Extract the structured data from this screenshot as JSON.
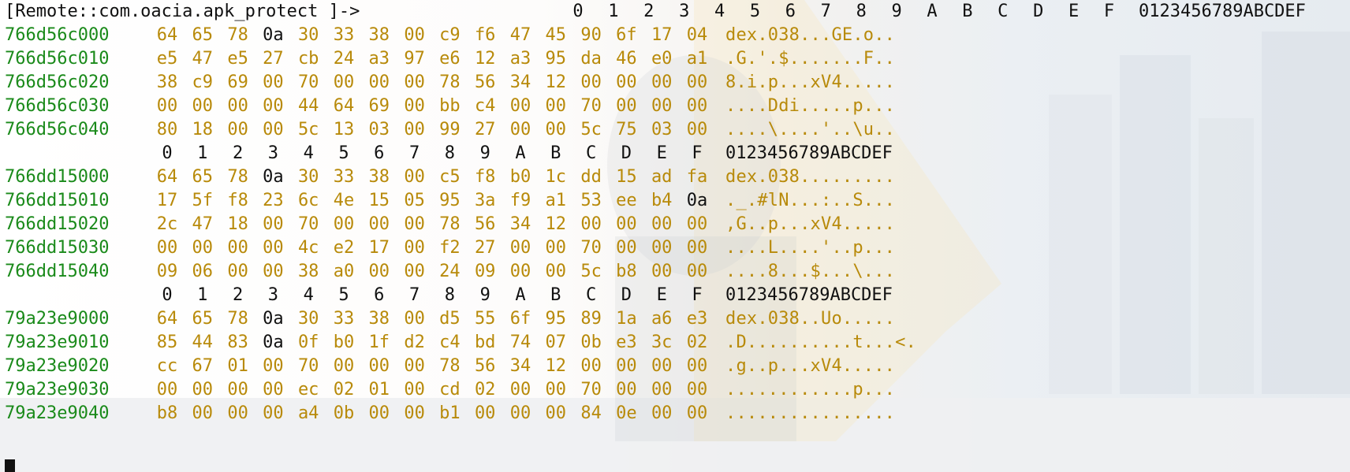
{
  "prompt": "[Remote::com.oacia.apk_protect ]->",
  "header": {
    "columns": [
      "0",
      "1",
      "2",
      "3",
      "4",
      "5",
      "6",
      "7",
      "8",
      "9",
      "A",
      "B",
      "C",
      "D",
      "E",
      "F"
    ],
    "ascii_label": "0123456789ABCDEF"
  },
  "blocks": [
    {
      "rows": [
        {
          "address": "766d56c000",
          "bytes": [
            "64",
            "65",
            "78",
            "0a",
            "30",
            "33",
            "38",
            "00",
            "c9",
            "f6",
            "47",
            "45",
            "90",
            "6f",
            "17",
            "04"
          ],
          "ascii": "dex.038...GE.o.."
        },
        {
          "address": "766d56c010",
          "bytes": [
            "e5",
            "47",
            "e5",
            "27",
            "cb",
            "24",
            "a3",
            "97",
            "e6",
            "12",
            "a3",
            "95",
            "da",
            "46",
            "e0",
            "a1"
          ],
          "ascii": ".G.'.$.......F.."
        },
        {
          "address": "766d56c020",
          "bytes": [
            "38",
            "c9",
            "69",
            "00",
            "70",
            "00",
            "00",
            "00",
            "78",
            "56",
            "34",
            "12",
            "00",
            "00",
            "00",
            "00"
          ],
          "ascii": "8.i.p...xV4....."
        },
        {
          "address": "766d56c030",
          "bytes": [
            "00",
            "00",
            "00",
            "00",
            "44",
            "64",
            "69",
            "00",
            "bb",
            "c4",
            "00",
            "00",
            "70",
            "00",
            "00",
            "00"
          ],
          "ascii": "....Ddi.....p..."
        },
        {
          "address": "766d56c040",
          "bytes": [
            "80",
            "18",
            "00",
            "00",
            "5c",
            "13",
            "03",
            "00",
            "99",
            "27",
            "00",
            "00",
            "5c",
            "75",
            "03",
            "00"
          ],
          "ascii": "....\\....'..\\u.."
        }
      ]
    },
    {
      "rows": [
        {
          "address": "766dd15000",
          "bytes": [
            "64",
            "65",
            "78",
            "0a",
            "30",
            "33",
            "38",
            "00",
            "c5",
            "f8",
            "b0",
            "1c",
            "dd",
            "15",
            "ad",
            "fa"
          ],
          "ascii": "dex.038........."
        },
        {
          "address": "766dd15010",
          "bytes": [
            "17",
            "5f",
            "f8",
            "23",
            "6c",
            "4e",
            "15",
            "05",
            "95",
            "3a",
            "f9",
            "a1",
            "53",
            "ee",
            "b4",
            "0a"
          ],
          "ascii": "._.#lN...:..S..."
        },
        {
          "address": "766dd15020",
          "bytes": [
            "2c",
            "47",
            "18",
            "00",
            "70",
            "00",
            "00",
            "00",
            "78",
            "56",
            "34",
            "12",
            "00",
            "00",
            "00",
            "00"
          ],
          "ascii": ",G..p...xV4....."
        },
        {
          "address": "766dd15030",
          "bytes": [
            "00",
            "00",
            "00",
            "00",
            "4c",
            "e2",
            "17",
            "00",
            "f2",
            "27",
            "00",
            "00",
            "70",
            "00",
            "00",
            "00"
          ],
          "ascii": "....L....'..p..."
        },
        {
          "address": "766dd15040",
          "bytes": [
            "09",
            "06",
            "00",
            "00",
            "38",
            "a0",
            "00",
            "00",
            "24",
            "09",
            "00",
            "00",
            "5c",
            "b8",
            "00",
            "00"
          ],
          "ascii": "....8...$...\\..."
        }
      ]
    },
    {
      "rows": [
        {
          "address": "79a23e9000",
          "bytes": [
            "64",
            "65",
            "78",
            "0a",
            "30",
            "33",
            "38",
            "00",
            "d5",
            "55",
            "6f",
            "95",
            "89",
            "1a",
            "a6",
            "e3"
          ],
          "ascii": "dex.038..Uo....."
        },
        {
          "address": "79a23e9010",
          "bytes": [
            "85",
            "44",
            "83",
            "0a",
            "0f",
            "b0",
            "1f",
            "d2",
            "c4",
            "bd",
            "74",
            "07",
            "0b",
            "e3",
            "3c",
            "02"
          ],
          "ascii": ".D..........t...<."
        },
        {
          "address": "79a23e9020",
          "bytes": [
            "cc",
            "67",
            "01",
            "00",
            "70",
            "00",
            "00",
            "00",
            "78",
            "56",
            "34",
            "12",
            "00",
            "00",
            "00",
            "00"
          ],
          "ascii": ".g..p...xV4....."
        },
        {
          "address": "79a23e9030",
          "bytes": [
            "00",
            "00",
            "00",
            "00",
            "ec",
            "02",
            "01",
            "00",
            "cd",
            "02",
            "00",
            "00",
            "70",
            "00",
            "00",
            "00"
          ],
          "ascii": "............p..."
        },
        {
          "address": "79a23e9040",
          "bytes": [
            "b8",
            "00",
            "00",
            "00",
            "a4",
            "0b",
            "00",
            "00",
            "b1",
            "00",
            "00",
            "00",
            "84",
            "0e",
            "00",
            "00"
          ],
          "ascii": "................"
        }
      ]
    }
  ],
  "colors": {
    "address": "#1a8a1a",
    "hex_bytes": "#b88a0a",
    "newline_byte": "#111111",
    "header": "#111111"
  }
}
